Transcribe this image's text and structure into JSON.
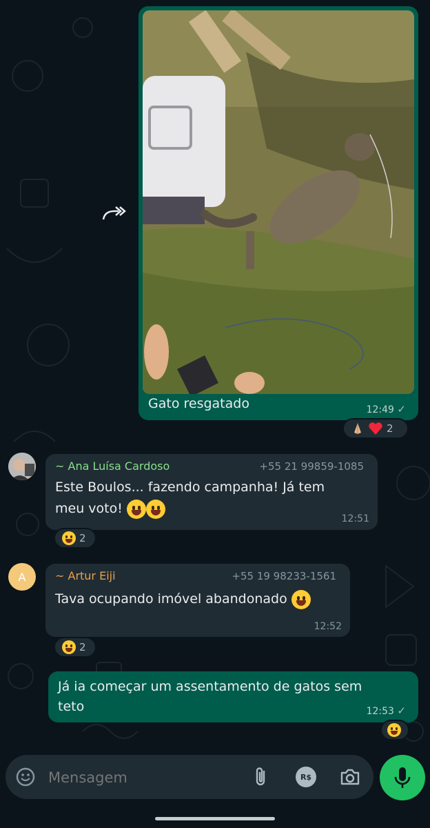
{
  "messages": [
    {
      "type": "image",
      "direction": "out",
      "caption": "Gato resgatado",
      "time": "12:49",
      "status": "sent",
      "reaction": {
        "emojis": [
          "folded-hands",
          "red-heart"
        ],
        "count": "2"
      }
    },
    {
      "type": "text",
      "direction": "in",
      "sender": "~ Ana Luísa Cardoso",
      "sender_color": "#86e08b",
      "phone": "+55 21 99859-1085",
      "text_line1": "Este Boulos... fazendo campanha! Já tem",
      "text_line2": "meu voto!",
      "text_emojis": [
        "zany-face",
        "grinning-sweat-face"
      ],
      "time": "12:51",
      "reaction": {
        "emoji": "face-with-tears-of-joy",
        "count": "2"
      }
    },
    {
      "type": "text",
      "direction": "in",
      "sender": "~ Artur Eiji",
      "sender_color": "#e8a24b",
      "avatar_letter": "A",
      "phone": "+55 19 98233-1561",
      "text": "Tava ocupando imóvel  abandonado",
      "text_emojis": [
        "squinting-face-with-tongue"
      ],
      "time": "12:52",
      "reaction": {
        "emoji": "face-with-tears-of-joy",
        "count": "2"
      }
    },
    {
      "type": "text",
      "direction": "out",
      "text_line1": "Já ia começar um assentamento de gatos sem",
      "text_line2": "teto",
      "time": "12:53",
      "status": "sent",
      "reaction": {
        "emoji": "face-with-tears-of-joy"
      }
    }
  ],
  "composer": {
    "placeholder": "Mensagem",
    "icons": [
      "emoji-icon",
      "attach-icon",
      "payment-icon",
      "camera-icon",
      "mic-icon"
    ],
    "payment_label": "R$"
  },
  "colors": {
    "background": "#0b141a",
    "outgoing_bubble": "#005c4b",
    "incoming_bubble": "#202c33",
    "accent": "#21c063"
  }
}
